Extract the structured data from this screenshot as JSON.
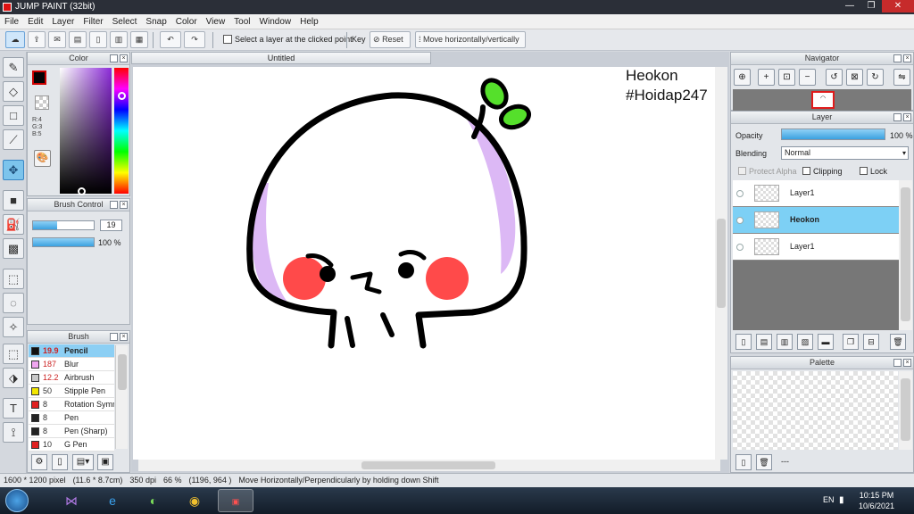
{
  "window": {
    "title": "JUMP PAINT (32bit)"
  },
  "menu": [
    "File",
    "Edit",
    "Layer",
    "Filter",
    "Select",
    "Snap",
    "Color",
    "View",
    "Tool",
    "Window",
    "Help"
  ],
  "toolbar": {
    "select_layer_label": "Select a layer at the clicked point",
    "key_label": "Key",
    "reset_label": "Reset",
    "move_hv_label": "Move horizontally/vertically"
  },
  "color_panel": {
    "title": "Color",
    "r_label": "R:4",
    "g_label": "G:3",
    "b_label": "B:5",
    "fg_color": "#040305"
  },
  "brush_control": {
    "title": "Brush Control",
    "size": "19",
    "opacity": "100 %"
  },
  "brush_panel": {
    "title": "Brush",
    "items": [
      {
        "size": "19.9",
        "name": "Pencil",
        "color": "#111111"
      },
      {
        "size": "187",
        "name": "Blur",
        "color": "#f0a6f0"
      },
      {
        "size": "12.2",
        "name": "Airbrush",
        "color": "#c8c8c8"
      },
      {
        "size": "50",
        "name": "Stipple Pen",
        "color": "#f2e600"
      },
      {
        "size": "8",
        "name": "Rotation Symmetry",
        "color": "#e02020"
      },
      {
        "size": "8",
        "name": "Pen",
        "color": "#222222"
      },
      {
        "size": "8",
        "name": "Pen (Sharp)",
        "color": "#222222"
      },
      {
        "size": "10",
        "name": "G Pen",
        "color": "#e02020"
      }
    ]
  },
  "document": {
    "tab_title": "Untitled",
    "watermark_line1": "Heokon",
    "watermark_line2": "#Hoidap247"
  },
  "navigator": {
    "title": "Navigator"
  },
  "layer_panel": {
    "title": "Layer",
    "opacity_label": "Opacity",
    "opacity_value": "100 %",
    "blending_label": "Blending",
    "blending_value": "Normal",
    "protect_alpha_label": "Protect Alpha",
    "clipping_label": "Clipping",
    "lock_label": "Lock",
    "layers": [
      {
        "name": "Layer1"
      },
      {
        "name": "Heokon"
      },
      {
        "name": "Layer1"
      }
    ]
  },
  "palette_panel": {
    "title": "Palette",
    "extra": "---"
  },
  "status": {
    "size_px": "1600 * 1200 pixel",
    "size_cm": "(11.6 * 8.7cm)",
    "dpi": "350 dpi",
    "zoom": "66 %",
    "coords": "(1196, 964 )",
    "hint": "Move Horizontally/Perpendicularly by holding down Shift"
  },
  "taskbar": {
    "lang": "EN",
    "time": "10:15 PM",
    "date": "10/6/2021"
  }
}
